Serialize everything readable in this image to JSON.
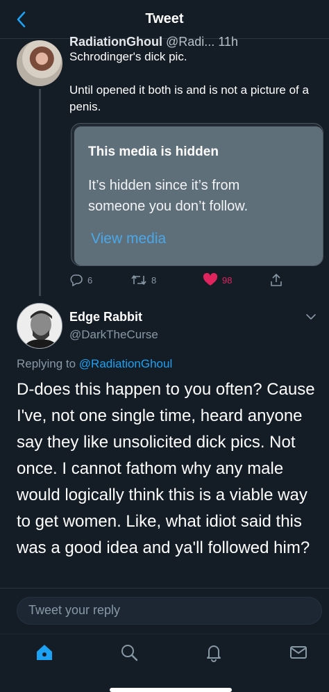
{
  "app": {
    "title": "Tweet"
  },
  "colors": {
    "background": "#141d26",
    "accent": "#1da1f2",
    "like": "#e0245e",
    "muted": "#8899a6"
  },
  "parent_tweet": {
    "author_partial": "RadiationGhoul",
    "handle_partial": "@Radi...",
    "time_partial": "11h",
    "text_line1": "Schrodinger's dick pic.",
    "text_line2": "Until opened it both is and is not a picture of a penis.",
    "media": {
      "title": "This media is hidden",
      "body": "It’s hidden since it’s from someone you don’t follow.",
      "link": "View media"
    },
    "actions": {
      "replies": "6",
      "retweets": "8",
      "likes": "98"
    },
    "icons": [
      "reply-icon",
      "retweet-icon",
      "heart-icon",
      "share-icon"
    ]
  },
  "reply_tweet": {
    "name": "Edge Rabbit",
    "handle": "@DarkTheCurse",
    "replying_prefix": "Replying to",
    "replying_to": "@RadiationGhoul",
    "text": "D-does this happen to you often? Cause I've, not one single time, heard anyone say they like unsolicited dick pics. Not once. I cannot fathom why any male would logically think this is a viable way to get women. Like, what idiot said this was a good idea and ya'll followed him?"
  },
  "compose": {
    "placeholder": "Tweet your reply"
  },
  "tabbar": {
    "items": [
      "home-icon",
      "search-icon",
      "notifications-icon",
      "messages-icon"
    ]
  }
}
